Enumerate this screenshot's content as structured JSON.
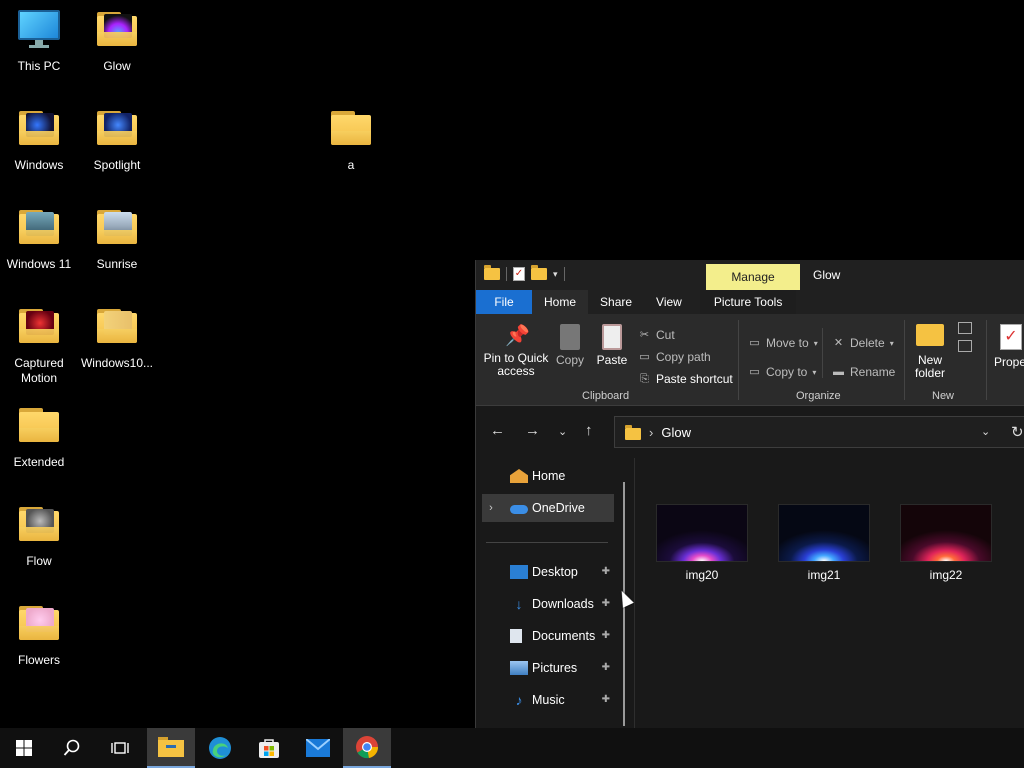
{
  "desktop": {
    "icons": [
      {
        "label": "This PC"
      },
      {
        "label": "Glow"
      },
      {
        "label": "Windows"
      },
      {
        "label": "Spotlight"
      },
      {
        "label": "a"
      },
      {
        "label": "Windows 11"
      },
      {
        "label": "Sunrise"
      },
      {
        "label": "Captured Motion"
      },
      {
        "label": "Windows10..."
      },
      {
        "label": "Extended"
      },
      {
        "label": "Flow"
      },
      {
        "label": "Flowers"
      }
    ]
  },
  "explorer": {
    "contextual_tab": "Manage",
    "title": "Glow",
    "tabs": [
      "File",
      "Home",
      "Share",
      "View",
      "Picture Tools"
    ],
    "ribbon": {
      "clipboard": {
        "pin_label": "Pin to Quick access",
        "copy_label": "Copy",
        "paste_label": "Paste",
        "cut_label": "Cut",
        "copy_path_label": "Copy path",
        "paste_shortcut_label": "Paste shortcut",
        "group_label": "Clipboard"
      },
      "organize": {
        "move_to_label": "Move to",
        "copy_to_label": "Copy to",
        "delete_label": "Delete",
        "rename_label": "Rename",
        "group_label": "Organize"
      },
      "new": {
        "new_folder_label": "New folder",
        "group_label": "New"
      },
      "open": {
        "properties_label": "Prope"
      }
    },
    "address": {
      "path": "Glow"
    },
    "nav": [
      {
        "label": "Home"
      },
      {
        "label": "OneDrive"
      },
      {
        "label": "Desktop"
      },
      {
        "label": "Downloads"
      },
      {
        "label": "Documents"
      },
      {
        "label": "Pictures"
      },
      {
        "label": "Music"
      }
    ],
    "files": [
      {
        "name": "img20"
      },
      {
        "name": "img21"
      },
      {
        "name": "img22"
      }
    ]
  },
  "colors": {
    "accent": "#1a6fd1",
    "manage_tab": "#f3ee8c",
    "folder": "#f5c242"
  }
}
